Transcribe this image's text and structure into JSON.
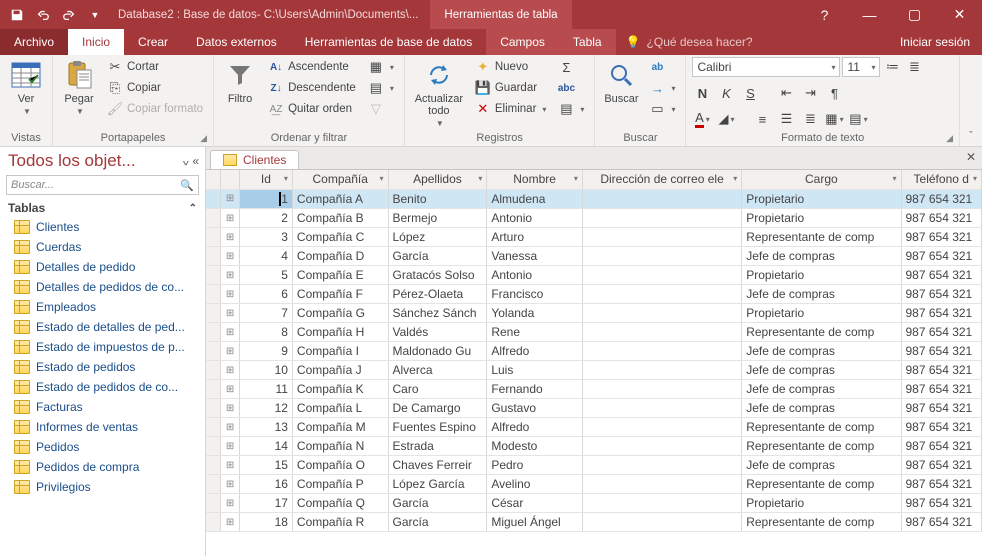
{
  "titlebar": {
    "doc_title": "Database2 : Base de datos- C:\\Users\\Admin\\Documents\\...",
    "tool_tab": "Herramientas de tabla"
  },
  "menutabs": {
    "file": "Archivo",
    "home": "Inicio",
    "create": "Crear",
    "external": "Datos externos",
    "dbtools": "Herramientas de base de datos",
    "fields": "Campos",
    "table": "Tabla",
    "tellme": "¿Qué desea hacer?",
    "signin": "Iniciar sesión"
  },
  "ribbon": {
    "views": {
      "label": "Vistas",
      "ver": "Ver"
    },
    "clipboard": {
      "label": "Portapapeles",
      "paste": "Pegar",
      "cut": "Cortar",
      "copy": "Copiar",
      "format_painter": "Copiar formato"
    },
    "sortfilter": {
      "label": "Ordenar y filtrar",
      "filter": "Filtro",
      "asc": "Ascendente",
      "desc": "Descendente",
      "clear": "Quitar orden"
    },
    "records": {
      "label": "Registros",
      "refresh": "Actualizar todo",
      "new": "Nuevo",
      "save": "Guardar",
      "delete": "Eliminar"
    },
    "find": {
      "label": "Buscar",
      "find": "Buscar"
    },
    "textfmt": {
      "label": "Formato de texto",
      "font_name": "Calibri",
      "font_size": "11"
    }
  },
  "nav": {
    "header": "Todos los objet...",
    "search_placeholder": "Buscar...",
    "group": "Tablas",
    "items": [
      "Clientes",
      "Cuerdas",
      "Detalles de pedido",
      "Detalles de pedidos de co...",
      "Empleados",
      "Estado de detalles de ped...",
      "Estado de impuestos de p...",
      "Estado de pedidos",
      "Estado de pedidos de co...",
      "Facturas",
      "Informes de ventas",
      "Pedidos",
      "Pedidos de compra",
      "Privilegios"
    ]
  },
  "datasheet": {
    "tab": "Clientes",
    "columns": [
      "Id",
      "Compañía",
      "Apellidos",
      "Nombre",
      "Dirección de correo ele",
      "Cargo",
      "Teléfono d"
    ],
    "rows": [
      {
        "id": "1",
        "company": "Compañía A",
        "last": "Benito",
        "first": "Almudena",
        "email": "",
        "role": "Propietario",
        "phone": "987 654 321"
      },
      {
        "id": "2",
        "company": "Compañía B",
        "last": "Bermejo",
        "first": "Antonio",
        "email": "",
        "role": "Propietario",
        "phone": "987 654 321"
      },
      {
        "id": "3",
        "company": "Compañía C",
        "last": "López",
        "first": "Arturo",
        "email": "",
        "role": "Representante de comp",
        "phone": "987 654 321"
      },
      {
        "id": "4",
        "company": "Compañía D",
        "last": "García",
        "first": "Vanessa",
        "email": "",
        "role": "Jefe de compras",
        "phone": "987 654 321"
      },
      {
        "id": "5",
        "company": "Compañía E",
        "last": "Gratacós Solso",
        "first": "Antonio",
        "email": "",
        "role": "Propietario",
        "phone": "987 654 321"
      },
      {
        "id": "6",
        "company": "Compañía F",
        "last": "Pérez-Olaeta",
        "first": "Francisco",
        "email": "",
        "role": "Jefe de compras",
        "phone": "987 654 321"
      },
      {
        "id": "7",
        "company": "Compañía G",
        "last": "Sánchez Sánch",
        "first": "Yolanda",
        "email": "",
        "role": "Propietario",
        "phone": "987 654 321"
      },
      {
        "id": "8",
        "company": "Compañía H",
        "last": "Valdés",
        "first": "Rene",
        "email": "",
        "role": "Representante de comp",
        "phone": "987 654 321"
      },
      {
        "id": "9",
        "company": "Compañía I",
        "last": "Maldonado Gu",
        "first": "Alfredo",
        "email": "",
        "role": "Jefe de compras",
        "phone": "987 654 321"
      },
      {
        "id": "10",
        "company": "Compañía J",
        "last": "Alverca",
        "first": "Luis",
        "email": "",
        "role": "Jefe de compras",
        "phone": "987 654 321"
      },
      {
        "id": "11",
        "company": "Compañía K",
        "last": "Caro",
        "first": "Fernando",
        "email": "",
        "role": "Jefe de compras",
        "phone": "987 654 321"
      },
      {
        "id": "12",
        "company": "Compañía L",
        "last": "De Camargo",
        "first": "Gustavo",
        "email": "",
        "role": "Jefe de compras",
        "phone": "987 654 321"
      },
      {
        "id": "13",
        "company": "Compañía M",
        "last": "Fuentes Espino",
        "first": "Alfredo",
        "email": "",
        "role": "Representante de comp",
        "phone": "987 654 321"
      },
      {
        "id": "14",
        "company": "Compañía N",
        "last": "Estrada",
        "first": "Modesto",
        "email": "",
        "role": "Representante de comp",
        "phone": "987 654 321"
      },
      {
        "id": "15",
        "company": "Compañía O",
        "last": "Chaves Ferreir",
        "first": "Pedro",
        "email": "",
        "role": "Jefe de compras",
        "phone": "987 654 321"
      },
      {
        "id": "16",
        "company": "Compañía P",
        "last": "López García",
        "first": "Avelino",
        "email": "",
        "role": "Representante de comp",
        "phone": "987 654 321"
      },
      {
        "id": "17",
        "company": "Compañía Q",
        "last": "García",
        "first": "César",
        "email": "",
        "role": "Propietario",
        "phone": "987 654 321"
      },
      {
        "id": "18",
        "company": "Compañía R",
        "last": "García",
        "first": "Miguel Ángel",
        "email": "",
        "role": "Representante de comp",
        "phone": "987 654 321"
      }
    ]
  }
}
